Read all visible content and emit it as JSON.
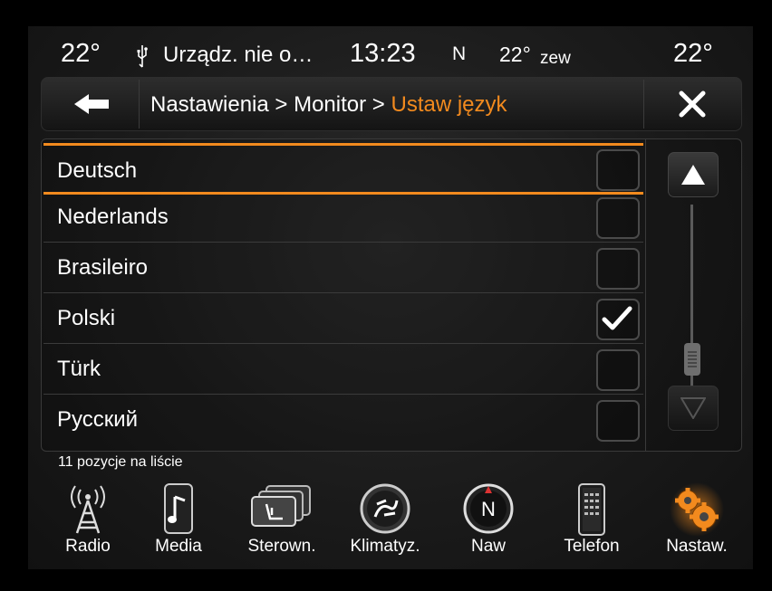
{
  "status": {
    "temp_left": "22°",
    "device": "Urządz. nie o…",
    "time": "13:23",
    "compass": "N",
    "outside_temp": "22°",
    "outside_label": "zew",
    "temp_right": "22°"
  },
  "header": {
    "crumb_1": "Nastawienia",
    "sep_1": ">",
    "crumb_2": "Monitor",
    "sep_2": ">",
    "crumb_current": "Ustaw język"
  },
  "languages": [
    {
      "label": "Deutsch",
      "checked": false,
      "selected": true
    },
    {
      "label": "Nederlands",
      "checked": false,
      "selected": false
    },
    {
      "label": "Brasileiro",
      "checked": false,
      "selected": false
    },
    {
      "label": "Polski",
      "checked": true,
      "selected": false
    },
    {
      "label": "Türk",
      "checked": false,
      "selected": false
    },
    {
      "label": "Русский",
      "checked": false,
      "selected": false
    }
  ],
  "list_count": "11 pozycje na liście",
  "nav": [
    {
      "label": "Radio",
      "icon": "radio-tower-icon"
    },
    {
      "label": "Media",
      "icon": "media-phone-icon"
    },
    {
      "label": "Sterown.",
      "icon": "controls-seats-icon"
    },
    {
      "label": "Klimatyz.",
      "icon": "climate-fan-icon"
    },
    {
      "label": "Naw",
      "icon": "compass-nav-icon"
    },
    {
      "label": "Telefon",
      "icon": "phone-icon"
    },
    {
      "label": "Nastaw.",
      "icon": "settings-gears-icon"
    }
  ],
  "colors": {
    "accent": "#f28a1e",
    "background": "#1b1b1b",
    "text": "#ffffff"
  }
}
